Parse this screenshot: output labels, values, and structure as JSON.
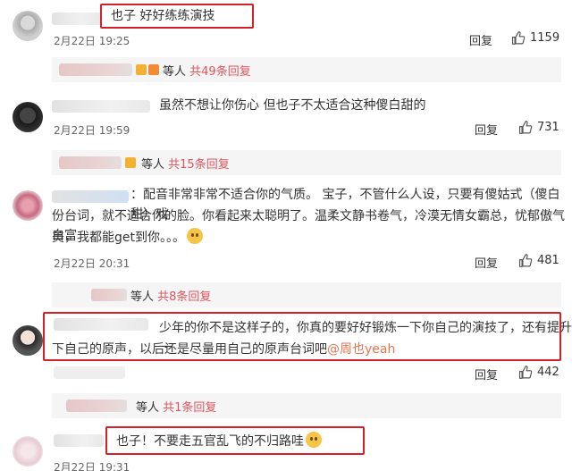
{
  "thumb_icon": "thumbs-up-icon",
  "reply_label": "回复",
  "accent_color": "#d42027",
  "comments": [
    {
      "text": "也子 好好练练演技",
      "date": "2月22日 19:25",
      "likes": "1159",
      "sub": {
        "people": "等人",
        "total": "共49条回复"
      }
    },
    {
      "text": "虽然不想让你伤心 但也子不太适合这种傻白甜的",
      "date": "2月22日 19:59",
      "likes": "731",
      "sub": {
        "people": "等人",
        "total": "共15条回复"
      }
    },
    {
      "text_line1": "：配音非常非常不适合你的气质。 宝子，不管什么人设，只要有傻姑式（傻白甜）戏",
      "text_line2": "份台词，就不适合你的脸。你看起来太聪明了。温柔文静书卷气，冷漠无情女霸总，忧郁傲气白富",
      "text_line3": "美，我都能get到你。。。",
      "date": "2月22日 20:31",
      "likes": "481",
      "sub": {
        "people": "等人",
        "total": "共8条回复"
      }
    },
    {
      "text_line1": "少年的你不是这样子的，你真的要好好锻炼一下你自己的演技了，还有提升一",
      "text_line2": "下自己的原声，以后还是尽量用自己的原声台词吧",
      "mention": "@周也yeah",
      "likes": "442",
      "sub": {
        "people": "等人",
        "total": "共1条回复"
      }
    },
    {
      "text": "也子！不要走五官乱飞的不归路哇",
      "date": "2月22日 19:31"
    }
  ]
}
